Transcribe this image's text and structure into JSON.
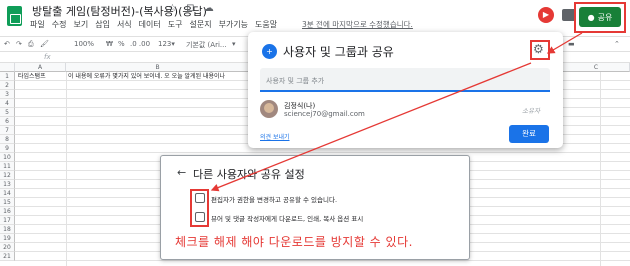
{
  "header": {
    "title": "방탈출 게임(탐정버전)-(복사용)(응답)",
    "title_icons": "☆ ⊡ ☁",
    "menu": [
      "파일",
      "수정",
      "보기",
      "삽입",
      "서식",
      "데이터",
      "도구",
      "설문지",
      "부가기능",
      "도움말"
    ],
    "last_edit": "3분 전에 마지막으로 수정했습니다.",
    "share_label": "공유",
    "share_color": "#188038"
  },
  "toolbar": {
    "zoom": "100%",
    "currency": "₩",
    "percent": "%",
    "decimals": ".0  .00",
    "number_format": "123▾",
    "font": "기본값 (Ari...",
    "font_arrow": "▾"
  },
  "sheet": {
    "columns": [
      "A",
      "B",
      "C"
    ],
    "header_row": {
      "a": "타임스탬프",
      "b": "이 내용에 오류가 몇가지 있어 보이네.  오 오늘 알게된 내용이나"
    },
    "row_numbers": [
      "1",
      "2",
      "3",
      "4",
      "5",
      "6",
      "7",
      "8",
      "9",
      "10",
      "11",
      "12",
      "13",
      "14",
      "15",
      "16",
      "17",
      "18",
      "19",
      "20",
      "21"
    ]
  },
  "share_dialog": {
    "title": "사용자 및 그룹과 공유",
    "add_placeholder": "사용자 및 그룹 추가",
    "owner_name": "김정식(나)",
    "owner_email": "sciencej70@gmail.com",
    "owner_role": "소유자",
    "feedback_link": "의견 보내기",
    "done_button": "완료"
  },
  "settings_dialog": {
    "title": "다른 사용자와 공유 설정",
    "options": [
      {
        "label": "편집자가 권한을 변경하고 공유할 수 있습니다.",
        "checked": false
      },
      {
        "label": "뷰어 및 댓글 작성자에게 다운로드, 인쇄, 복사 옵션 표시",
        "checked": false
      }
    ],
    "note": "체크를 해제 해야 다운로드를 방지할 수 있다.",
    "accent_red": "#e53935"
  }
}
